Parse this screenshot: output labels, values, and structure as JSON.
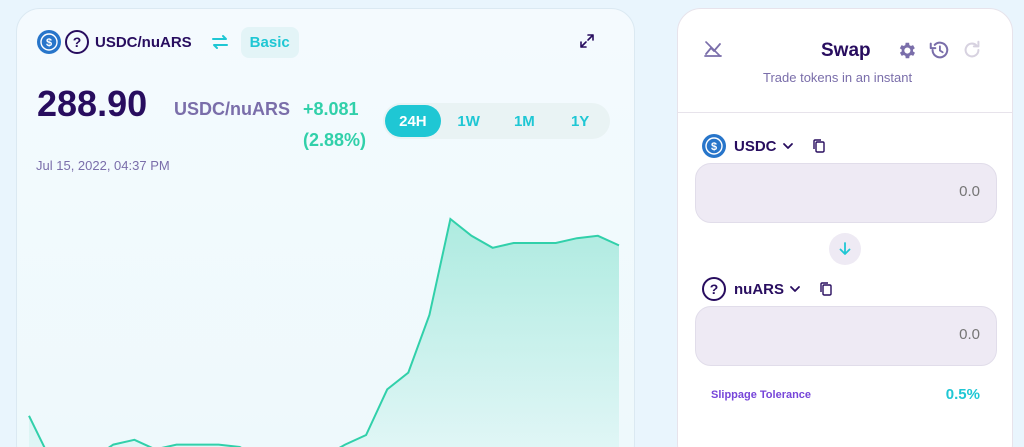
{
  "chart": {
    "pair_label": "USDC/nuARS",
    "view_mode": "Basic",
    "price": "288.90",
    "price_pair": "USDC/nuARS",
    "change_value": "+8.081",
    "change_percent": "(2.88%)",
    "timestamp": "Jul 15, 2022, 04:37 PM",
    "range_tabs": [
      {
        "label": "24H",
        "active": true
      },
      {
        "label": "1W",
        "active": false
      },
      {
        "label": "1M",
        "active": false
      },
      {
        "label": "1Y",
        "active": false
      }
    ],
    "line_color": "#31d0aa"
  },
  "chart_data": {
    "type": "area",
    "title": "",
    "xlabel": "",
    "ylabel": "",
    "y_relative": [
      0.18,
      0.0,
      0.02,
      0.0,
      0.06,
      0.08,
      0.04,
      0.06,
      0.06,
      0.06,
      0.05,
      0.0,
      0.04,
      0.01,
      0.01,
      0.06,
      0.1,
      0.29,
      0.36,
      0.6,
      1.0,
      0.93,
      0.88,
      0.9,
      0.9,
      0.9,
      0.92,
      0.93,
      0.89
    ],
    "grid": false,
    "legend": "none"
  },
  "swap": {
    "title": "Swap",
    "subtitle": "Trade tokens in an instant",
    "from_token": "USDC",
    "from_amount_placeholder": "0.0",
    "to_token": "nuARS",
    "to_amount_placeholder": "0.0",
    "slippage_label": "Slippage Tolerance",
    "slippage_value": "0.5%"
  },
  "colors": {
    "accent": "#1fc7d4",
    "positive": "#31d0aa",
    "text_primary": "#280d5f",
    "text_secondary": "#7a6eaa"
  }
}
